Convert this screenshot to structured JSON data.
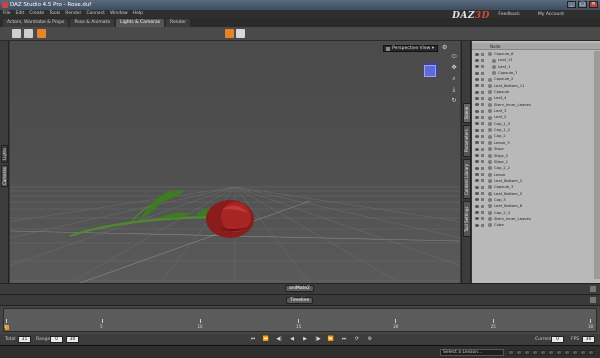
{
  "window": {
    "title": "DAZ Studio 4.5 Pro - Rose.duf",
    "min": "_",
    "max": "□",
    "close": "✕"
  },
  "menu": [
    "File",
    "Edit",
    "Create",
    "Tools",
    "Render",
    "Connect",
    "Window",
    "Help"
  ],
  "brand": {
    "daz": "DAZ",
    "three": "3D"
  },
  "top_links": {
    "feedback": "Feedback",
    "account": "My Account"
  },
  "tabs": [
    "Actors, Wardrobe & Props",
    "Pose & Animate",
    "Lights & Cameras",
    "Render"
  ],
  "active_tab": "Lights & Cameras",
  "left_tabs": {
    "lights": "Lights",
    "cameras": "Cameras"
  },
  "viewport": {
    "view_select": "Perspective View",
    "view_arrow": "▾"
  },
  "right_tabs": {
    "scene": "Scene",
    "parameters": "Parameters",
    "content_library": "Content Library",
    "tool_settings": "Tool Settings"
  },
  "scene": {
    "header": "Node",
    "nodes": [
      {
        "label": "Capsule_6",
        "depth": 0
      },
      {
        "label": "Leaf_11",
        "depth": 1
      },
      {
        "label": "Leaf_1",
        "depth": 1
      },
      {
        "label": "Capsule_7",
        "depth": 1
      },
      {
        "label": "Capsule_2",
        "depth": 0
      },
      {
        "label": "Leaf_Bottom_11",
        "depth": 0
      },
      {
        "label": "Capsule",
        "depth": 0
      },
      {
        "label": "Leaf_4",
        "depth": 0
      },
      {
        "label": "Stem_Inner_Leaves",
        "depth": 0
      },
      {
        "label": "Leaf_3",
        "depth": 0
      },
      {
        "label": "Leaf_2",
        "depth": 0
      },
      {
        "label": "Cap_1_3",
        "depth": 0
      },
      {
        "label": "Cap_1_2",
        "depth": 0
      },
      {
        "label": "Cap_2",
        "depth": 0
      },
      {
        "label": "Leave_3",
        "depth": 0
      },
      {
        "label": "Stipe",
        "depth": 0
      },
      {
        "label": "Stipe_2",
        "depth": 0
      },
      {
        "label": "Stipe_1",
        "depth": 0
      },
      {
        "label": "Cap_2_2",
        "depth": 0
      },
      {
        "label": "Leave",
        "depth": 0
      },
      {
        "label": "Leaf_Bottom_2",
        "depth": 0
      },
      {
        "label": "Capsule_3",
        "depth": 0
      },
      {
        "label": "Leaf_Bottom_5",
        "depth": 0
      },
      {
        "label": "Cap_3",
        "depth": 0
      },
      {
        "label": "Leaf_Bottom_8",
        "depth": 0
      },
      {
        "label": "Cap_2_3",
        "depth": 0
      },
      {
        "label": "Stem_Inner_Leaves",
        "depth": 0
      },
      {
        "label": "Cube",
        "depth": 0
      }
    ]
  },
  "panels": {
    "aniMate": "aniMate2",
    "timeline": "Timeline"
  },
  "timeline": {
    "ticks": [
      {
        "label": "0",
        "pos": 0.0
      },
      {
        "label": "5",
        "pos": 0.163
      },
      {
        "label": "10",
        "pos": 0.328
      },
      {
        "label": "15",
        "pos": 0.495
      },
      {
        "label": "20",
        "pos": 0.66
      },
      {
        "label": "25",
        "pos": 0.825
      },
      {
        "label": "30",
        "pos": 0.99
      }
    ]
  },
  "controls": {
    "total_label": "Total",
    "total_value": "31",
    "range_label": "Range",
    "range_start": "0",
    "range_end": "30",
    "current_label": "Current",
    "current_value": "0",
    "fps_label": "FPS",
    "fps_value": "30",
    "buttons": [
      "⏮",
      "⏪",
      "◀|",
      "◀",
      "▶",
      "|▶",
      "⏩",
      "⏭",
      "⟳",
      "⚙"
    ]
  },
  "status": {
    "lesson": "Select a Lesson..."
  }
}
